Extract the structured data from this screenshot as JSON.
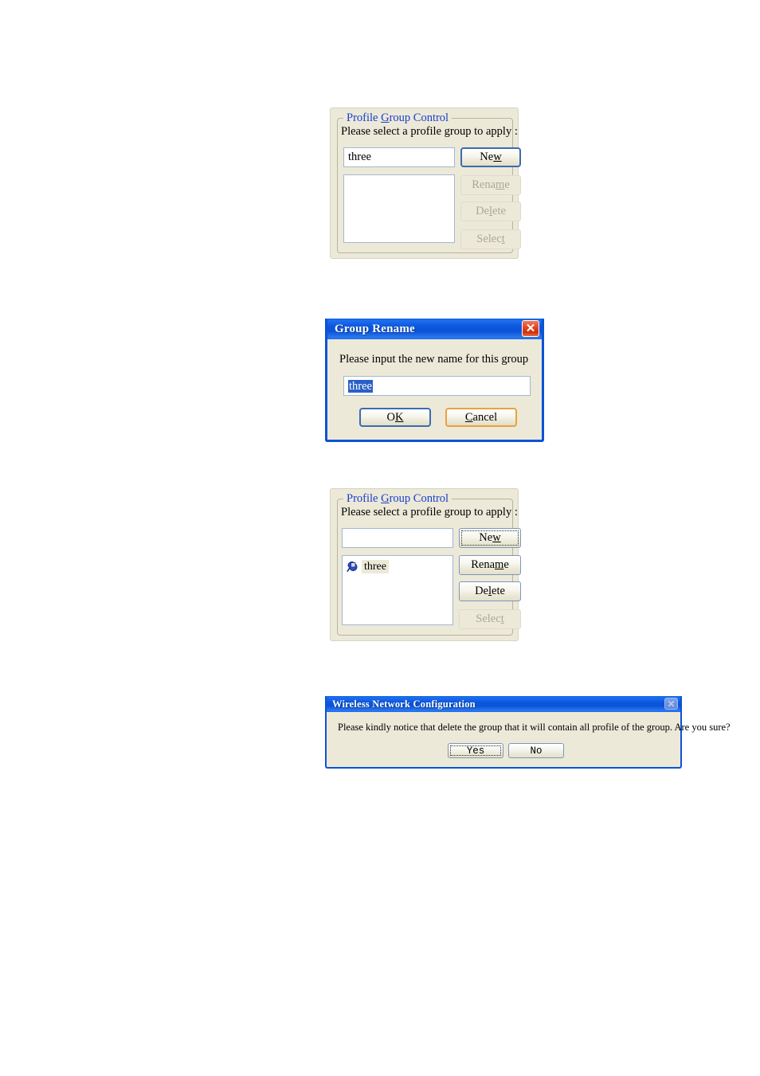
{
  "panel_one": {
    "legend_prefix": "Profile ",
    "legend_accel": "G",
    "legend_suffix": "roup Control",
    "prompt": "Please select a profile group to apply :",
    "textbox_value": "three",
    "textbox_placeholder": "",
    "buttons": {
      "new_prefix": "Ne",
      "new_accel": "w",
      "new_suffix": "",
      "rename_prefix": "Rena",
      "rename_accel": "m",
      "rename_suffix": "e",
      "delete_prefix": "De",
      "delete_accel": "l",
      "delete_suffix": "ete",
      "select_prefix": "Selec",
      "select_accel": "t",
      "select_suffix": ""
    }
  },
  "rename_dialog": {
    "title": "Group Rename",
    "close_icon": "close-icon",
    "close_glyph": "✕",
    "prompt": "Please input the new name for this group",
    "input_value": "three",
    "ok_prefix": "O",
    "ok_accel": "K",
    "ok_suffix": "",
    "cancel_prefix": "",
    "cancel_accel": "C",
    "cancel_suffix": "ancel"
  },
  "panel_two": {
    "legend_prefix": "Profile ",
    "legend_accel": "G",
    "legend_suffix": "roup Control",
    "prompt": "Please select a profile group to apply :",
    "textbox_value": "",
    "list_items": [
      {
        "icon": "profile-group-icon",
        "label": "three"
      }
    ],
    "buttons": {
      "new_prefix": "Ne",
      "new_accel": "w",
      "new_suffix": "",
      "rename_prefix": "Rena",
      "rename_accel": "m",
      "rename_suffix": "e",
      "delete_prefix": "De",
      "delete_accel": "l",
      "delete_suffix": "ete",
      "select_prefix": "Selec",
      "select_accel": "t",
      "select_suffix": ""
    }
  },
  "warning_dialog": {
    "title": "Wireless Network Configuration",
    "close_icon": "close-icon",
    "close_glyph": "✕",
    "message": "Please kindly notice that delete the group that it will contain all profile of the group. Are you sure?",
    "yes_label": "Yes",
    "no_label": "No"
  },
  "colors": {
    "accent_blue": "#1a3fd0",
    "titlebar_blue": "#0b53d7",
    "face": "#ece9d8",
    "default_border": "#3c6bb0",
    "hover_border": "#e8a33d",
    "selection": "#2a5fc8",
    "close_red": "#cf3010"
  }
}
